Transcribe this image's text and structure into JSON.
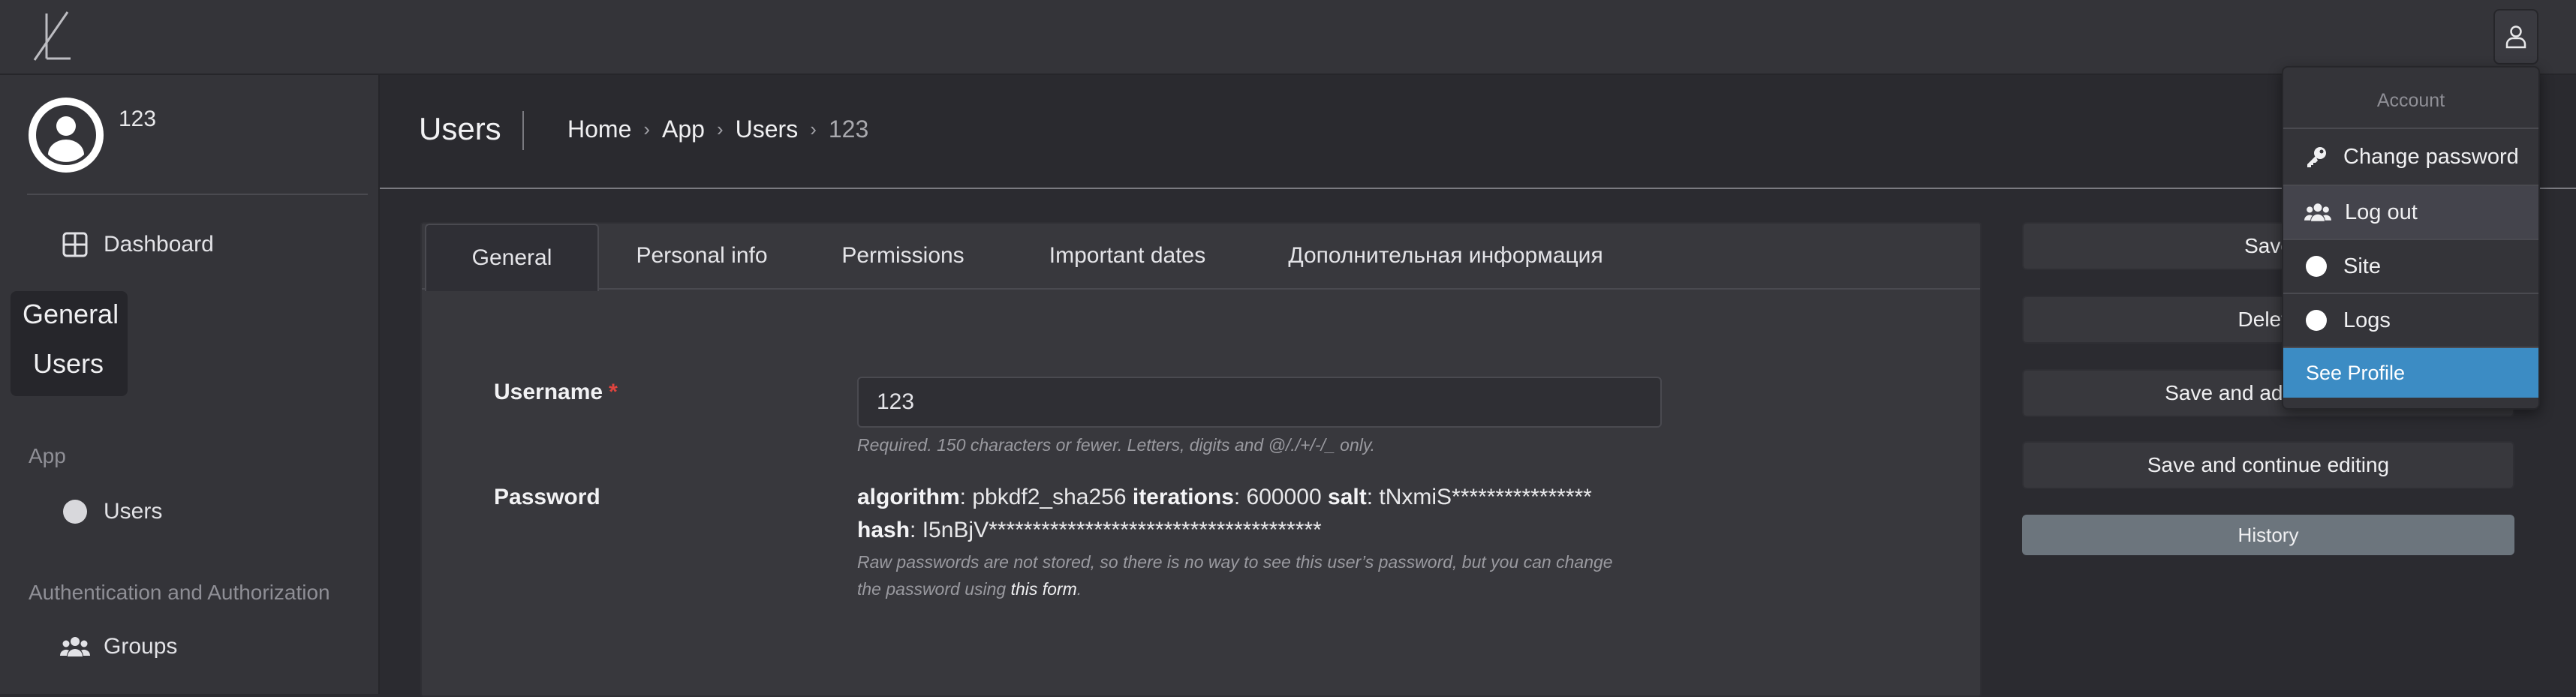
{
  "topbar": {
    "logo_icon": "brand-logo-icon",
    "user_menu_icon": "user-outline-icon"
  },
  "sidebar": {
    "username": "123",
    "items": [
      {
        "label": "Dashboard",
        "icon": "dashboard-grid-icon"
      }
    ],
    "highlight_group": {
      "line1": "General",
      "line2": "Users"
    },
    "sections": [
      {
        "title": "App",
        "items": [
          {
            "label": "Users",
            "icon": "circle-icon"
          }
        ]
      },
      {
        "title": "Authentication and Authorization",
        "items": [
          {
            "label": "Groups",
            "icon": "users-group-icon"
          }
        ]
      }
    ]
  },
  "header": {
    "title": "Users",
    "breadcrumbs": [
      "Home",
      "App",
      "Users"
    ],
    "breadcrumb_current": "123",
    "separator": "›"
  },
  "tabs": [
    "General",
    "Personal info",
    "Permissions",
    "Important dates",
    "Дополнительная информация"
  ],
  "form": {
    "username_label": "Username",
    "required_mark": "*",
    "username_value": "123",
    "username_help": "Required. 150 characters or fewer. Letters, digits and @/./+/-/_ only.",
    "password_label": "Password",
    "pw_algorithm_key": "algorithm",
    "pw_algorithm_val": ": pbkdf2_sha256 ",
    "pw_iterations_key": "iterations",
    "pw_iterations_val": ": 600000 ",
    "pw_salt_key": "salt",
    "pw_salt_val": ": tNxmiS****************",
    "pw_hash_key": "hash",
    "pw_hash_val": ": I5nBjV**************************************",
    "password_help_1": "Raw passwords are not stored, so there is no way to see this user’s password, but you can change",
    "password_help_2": "the password using ",
    "password_help_link": "this form",
    "password_help_end": "."
  },
  "actions": {
    "save": "Save",
    "delete": "Delete",
    "save_add": "Save and add another",
    "save_continue": "Save and continue editing",
    "history": "History"
  },
  "dropdown": {
    "header": "Account",
    "items": [
      {
        "label": "Change password",
        "icon": "key-icon"
      },
      {
        "label": "Log out",
        "icon": "users-group-icon"
      },
      {
        "label": "Site",
        "icon": "circle-icon"
      },
      {
        "label": "Logs",
        "icon": "circle-icon"
      }
    ],
    "see_profile": "See Profile"
  },
  "colors": {
    "background": "#2b2b30",
    "panel": "#343439",
    "card": "#38383d",
    "accent_primary": "#3c8cc4",
    "history_button": "#6c757d",
    "required": "#e0443e"
  }
}
